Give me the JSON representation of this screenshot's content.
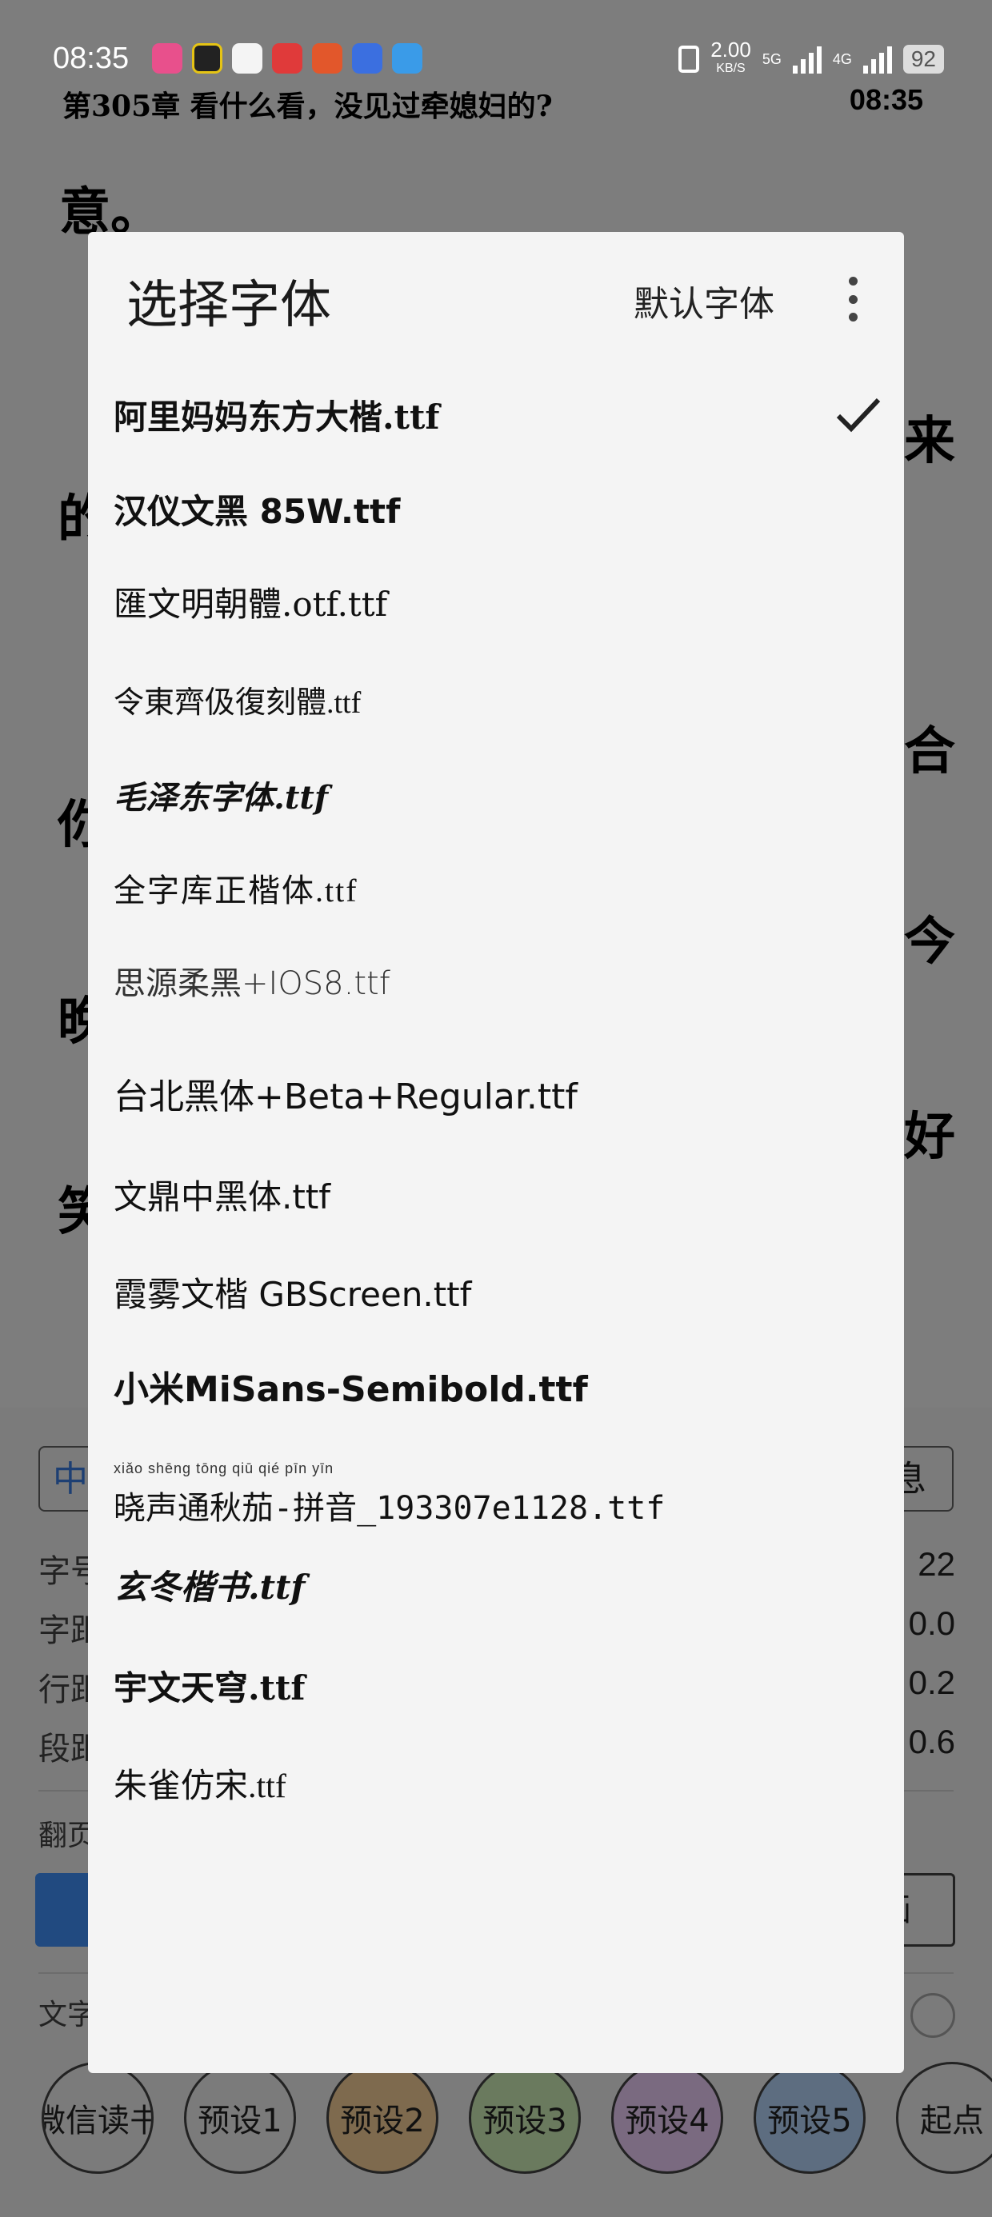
{
  "status_bar": {
    "time": "08:35",
    "net_speed": "2.00",
    "net_unit": "KB/S",
    "sig1": "5G",
    "sig2": "4G",
    "battery": "92"
  },
  "reader": {
    "chapter_title": "第305章 看什么看，没见过牵媳妇的?",
    "time": "08:35",
    "chars": [
      "意。",
      "的",
      "你",
      "晚",
      "笑",
      "来",
      "合",
      "今",
      "好"
    ]
  },
  "dialog": {
    "title": "选择字体",
    "default_button": "默认字体",
    "fonts": [
      "阿里妈妈东方大楷.ttf",
      "汉仪文黑 85W.ttf",
      "匯文明朝體.otf.ttf",
      "令東齊伋復刻體.ttf",
      "毛泽东字体.ttf",
      "全字库正楷体.ttf",
      "思源柔黑+IOS8.ttf",
      "台北黑体+Beta+Regular.ttf",
      "文鼎中黑体.ttf",
      "霞雾文楷 GBScreen.ttf",
      "小米MiSans-Semibold.ttf",
      "晓声通秋茄-拼音_193307e1128.ttf",
      "玄冬楷书.ttf",
      "宇文天穹.ttf",
      "朱雀仿宋.ttf"
    ],
    "ruby_text": "xiǎo shēng tōng qiū qié   pīn yīn",
    "selected_index": 0
  },
  "settings_panel": {
    "left_field": "中",
    "right_field": "息",
    "rows": [
      {
        "label": "字号",
        "value": "22"
      },
      {
        "label": "字距",
        "value": "0.0"
      },
      {
        "label": "行距",
        "value": "0.2"
      },
      {
        "label": "段距",
        "value": "0.6"
      }
    ],
    "page_turn_label": "翻页",
    "page_turn_button": "画",
    "text_label": "文字",
    "presets": [
      "微信读书",
      "预设1",
      "预设2",
      "预设3",
      "预设4",
      "预设5",
      "起点"
    ],
    "preset_colors": [
      "#7b7b7b",
      "#7b7b7b",
      "#7e6a4e",
      "#6a7a5e",
      "#7a6a80",
      "#5d6d80",
      "#7b7b7b"
    ]
  }
}
